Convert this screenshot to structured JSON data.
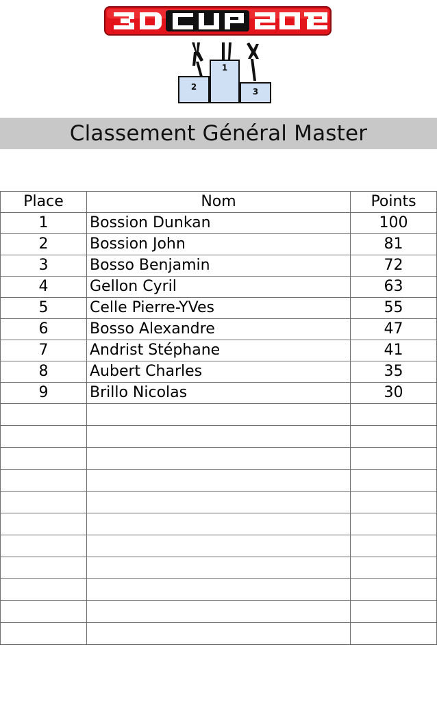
{
  "header": {
    "logo_text": "3D CUP 2012",
    "podium_labels": [
      "1",
      "2",
      "3"
    ]
  },
  "title": "Classement Général Master",
  "table": {
    "headers": {
      "place": "Place",
      "name": "Nom",
      "points": "Points"
    },
    "rows": [
      {
        "place": "1",
        "name": "Bossion Dunkan",
        "points": "100"
      },
      {
        "place": "2",
        "name": "Bossion John",
        "points": "81"
      },
      {
        "place": "3",
        "name": "Bosso Benjamin",
        "points": "72"
      },
      {
        "place": "4",
        "name": "Gellon Cyril",
        "points": "63"
      },
      {
        "place": "5",
        "name": "Celle Pierre-YVes",
        "points": "55"
      },
      {
        "place": "6",
        "name": "Bosso Alexandre",
        "points": "47"
      },
      {
        "place": "7",
        "name": "Andrist Stéphane",
        "points": "41"
      },
      {
        "place": "8",
        "name": "Aubert Charles",
        "points": "35"
      },
      {
        "place": "9",
        "name": "Brillo Nicolas",
        "points": "30"
      },
      {
        "place": "",
        "name": "",
        "points": ""
      },
      {
        "place": "",
        "name": "",
        "points": ""
      },
      {
        "place": "",
        "name": "",
        "points": ""
      },
      {
        "place": "",
        "name": "",
        "points": ""
      },
      {
        "place": "",
        "name": "",
        "points": ""
      },
      {
        "place": "",
        "name": "",
        "points": ""
      },
      {
        "place": "",
        "name": "",
        "points": ""
      },
      {
        "place": "",
        "name": "",
        "points": ""
      },
      {
        "place": "",
        "name": "",
        "points": ""
      },
      {
        "place": "",
        "name": "",
        "points": ""
      },
      {
        "place": "",
        "name": "",
        "points": ""
      }
    ]
  },
  "colors": {
    "logo_red": "#e3141b",
    "title_bar": "#c8c8c8",
    "podium_fill": "#cfe0f5"
  }
}
